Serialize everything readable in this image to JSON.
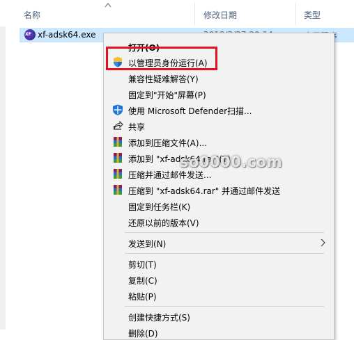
{
  "header": {
    "col_name": "名称",
    "col_date": "修改日期",
    "col_type": "类型"
  },
  "file": {
    "name": "xf-adsk64.exe",
    "date": "2019/2/27 20:14",
    "type": "应用程序",
    "icon_text": "XF"
  },
  "menu": {
    "open": "打开(O)",
    "run_as_admin": "以管理员身份运行(A)",
    "compat": "兼容性疑难解答(Y)",
    "pin_start": "固定到\"开始\"屏幕(P)",
    "defender": "使用 Microsoft Defender扫描...",
    "share": "共享",
    "add_archive": "添加到压缩文件(A)...",
    "add_rar": "添加到 \"xf-adsk64.rar\"(T)",
    "compress_email": "压缩并通过邮件发送...",
    "compress_rar_email": "压缩到 \"xf-adsk64.rar\" 并通过邮件发送",
    "pin_taskbar": "固定到任务栏(K)",
    "restore": "还原以前的版本(V)",
    "send_to": "发送到(N)",
    "cut": "剪切(T)",
    "copy": "复制(C)",
    "paste": "粘贴(P)",
    "shortcut": "创建快捷方式(S)",
    "delete": "删除(D)"
  },
  "watermark": "so0000.com",
  "colors": {
    "highlight": "#e0141e",
    "selection": "#cce8ff",
    "menu_bg": "#f2f2f2"
  },
  "icons": [
    "sort-up-icon",
    "exe-app-icon",
    "uac-shield-icon",
    "defender-icon",
    "share-icon",
    "winrar-icon",
    "chevron-right-icon"
  ]
}
